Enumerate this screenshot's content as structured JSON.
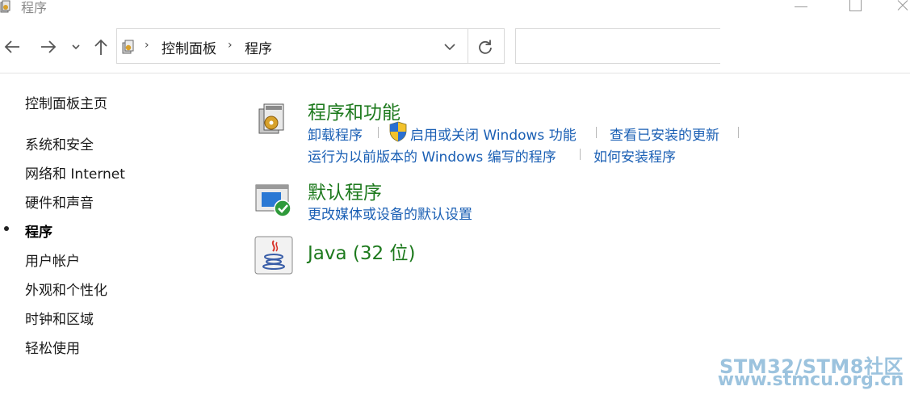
{
  "window": {
    "title": "程序",
    "icon": "control-panel-programs-icon"
  },
  "address_bar": {
    "breadcrumbs": [
      "控制面板",
      "程序"
    ],
    "search_placeholder": ""
  },
  "sidebar": {
    "home_label": "控制面板主页",
    "items": [
      {
        "label": "系统和安全",
        "active": false
      },
      {
        "label": "网络和 Internet",
        "active": false
      },
      {
        "label": "硬件和声音",
        "active": false
      },
      {
        "label": "程序",
        "active": true
      },
      {
        "label": "用户帐户",
        "active": false
      },
      {
        "label": "外观和个性化",
        "active": false
      },
      {
        "label": "时钟和区域",
        "active": false
      },
      {
        "label": "轻松使用",
        "active": false
      }
    ]
  },
  "categories": [
    {
      "title": "程序和功能",
      "icon": "programs-features-icon",
      "links": [
        "卸载程序",
        "启用或关闭 Windows 功能",
        "查看已安装的更新",
        "运行为以前版本的 Windows 编写的程序",
        "如何安装程序"
      ]
    },
    {
      "title": "默认程序",
      "icon": "default-programs-icon",
      "links": [
        "更改媒体或设备的默认设置"
      ]
    },
    {
      "title": "Java (32 位)",
      "icon": "java-icon",
      "links": []
    }
  ],
  "watermark": {
    "line1": "STM32/STM8社区",
    "line2": "www.stmcu.org.cn"
  },
  "colors": {
    "category_title": "#1e7a1e",
    "link": "#1a5fb4",
    "watermark": "#9cc3de"
  }
}
